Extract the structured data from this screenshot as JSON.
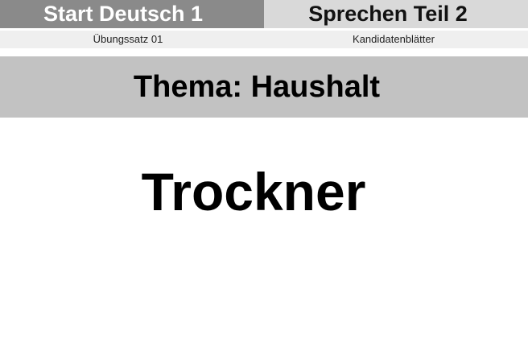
{
  "header": {
    "exam_title": "Start Deutsch 1",
    "section_title": "Sprechen Teil 2"
  },
  "subheader": {
    "set_label": "Übungssatz 01",
    "sheet_label": "Kandidatenblätter"
  },
  "theme": {
    "label": "Thema: Haushalt"
  },
  "card": {
    "word": "Trockner"
  },
  "colors": {
    "header_left_bg": "#8a8a8a",
    "header_right_bg": "#d9d9d9",
    "theme_bar_bg": "#c2c2c2",
    "page_bg": "#ffffff"
  }
}
